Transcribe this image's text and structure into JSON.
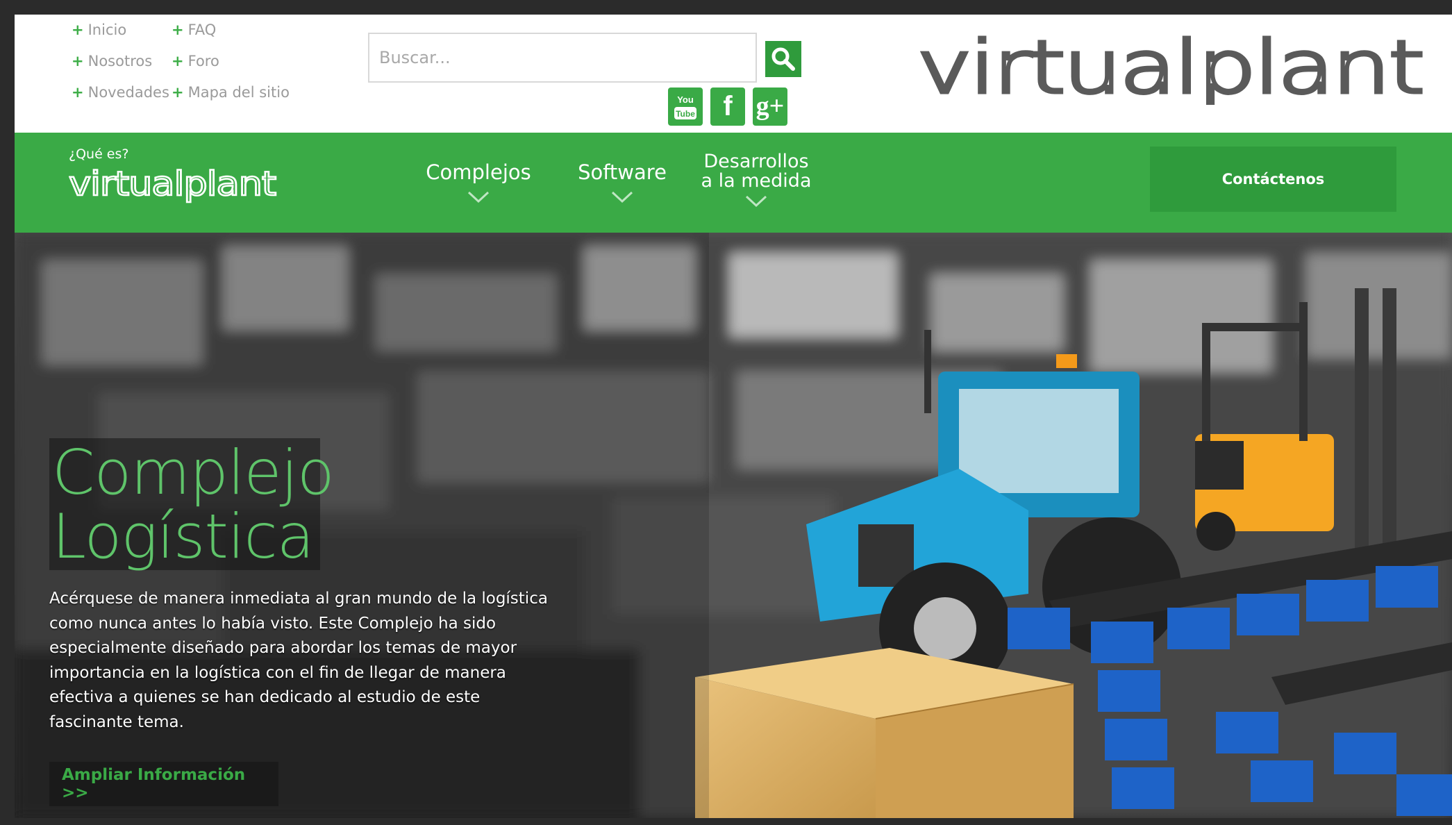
{
  "quick_links": [
    {
      "label": "Inicio"
    },
    {
      "label": "FAQ"
    },
    {
      "label": "Nosotros"
    },
    {
      "label": "Foro"
    },
    {
      "label": "Novedades"
    },
    {
      "label": "Mapa del sitio"
    }
  ],
  "search": {
    "placeholder": "Buscar...",
    "button_icon": "search-icon"
  },
  "social": [
    {
      "name": "youtube",
      "label": "You"
    },
    {
      "name": "facebook",
      "label": "f"
    },
    {
      "name": "google-plus",
      "label": "g+"
    }
  ],
  "brand": {
    "logo_text": "virtualplant"
  },
  "nav": {
    "logo_question": "¿Qué es?",
    "logo_text": "virtualplant",
    "items": [
      {
        "label": "Complejos"
      },
      {
        "label": "Software"
      },
      {
        "label_line1": "Desarrollos",
        "label_line2": "a la medida"
      }
    ],
    "contact_label": "Contáctenos"
  },
  "hero": {
    "title_line1": "Complejo",
    "title_line2": "Logística",
    "description": "Acérquese de manera inmediata al gran mundo de la logística como nunca antes lo había visto. Este Complejo ha sido especialmente diseñado para abordar los temas de mayor importancia en la logística con el fin de llegar de manera efectiva a quienes se han dedicado al estudio de este fascinante tema.",
    "more_label": "Ampliar Información >>"
  },
  "colors": {
    "green": "#3aaa46",
    "dark_green": "#2f9b3c",
    "title_green": "#5fc46a"
  }
}
